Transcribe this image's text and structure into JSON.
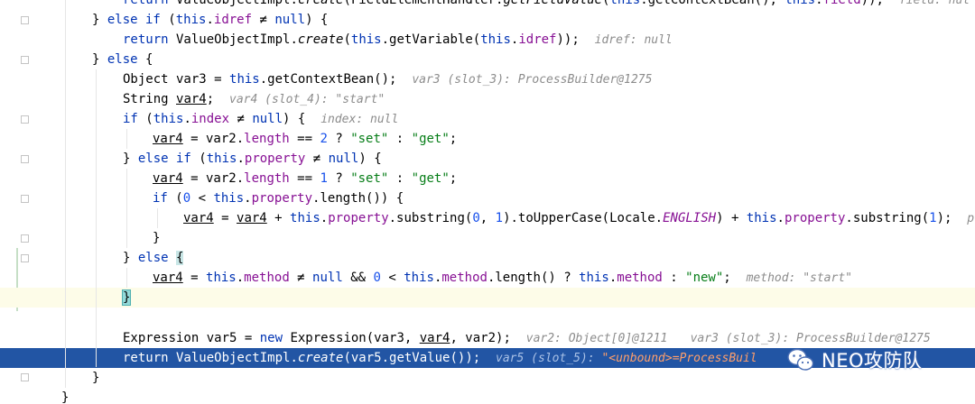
{
  "editor": {
    "lines": [
      {
        "id": "l0"
      },
      {
        "id": "l1"
      },
      {
        "id": "l2"
      },
      {
        "id": "l3"
      },
      {
        "id": "l4"
      },
      {
        "id": "l5"
      },
      {
        "id": "l6"
      },
      {
        "id": "l7"
      },
      {
        "id": "l8"
      },
      {
        "id": "l9"
      },
      {
        "id": "l10"
      },
      {
        "id": "l11"
      },
      {
        "id": "l12"
      },
      {
        "id": "l13"
      },
      {
        "id": "l14"
      },
      {
        "id": "l15"
      },
      {
        "id": "l16"
      },
      {
        "id": "l17"
      },
      {
        "id": "l18"
      },
      {
        "id": "l19"
      }
    ],
    "hints": {
      "idref": "idref: null",
      "var3": "var3 (slot_3): ProcessBuilder@1275",
      "var4": "var4 (slot_4): \"start\"",
      "index": "index: null",
      "method": "method: \"start\"",
      "var2": "var2: Object[0]@1211",
      "var3b": "var3 (slot_3): ProcessBuilder@1275",
      "var5_name": "var5 (slot_5): ",
      "var5_val": "\"<unbound>=ProcessBuil",
      "field_trunc": "field: nul",
      "p_trunc": "p"
    },
    "watermark": {
      "text": "NEO攻防队",
      "icon": "wechat-icon"
    }
  }
}
